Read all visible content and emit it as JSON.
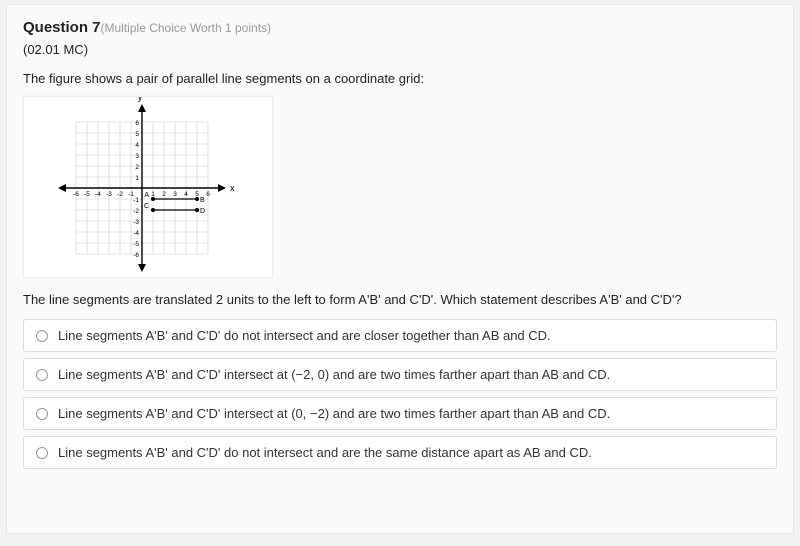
{
  "question": {
    "title": "Question 7",
    "meta": "(Multiple Choice Worth 1 points)",
    "code": "(02.01 MC)",
    "prompt1": "The figure shows a pair of parallel line segments on a coordinate grid:",
    "prompt2": "The line segments are translated 2 units to the left to form A'B' and C'D'. Which statement describes A'B' and C'D'?"
  },
  "options": [
    "Line segments A'B' and C'D' do not intersect and are closer together than AB and CD.",
    "Line segments A'B' and C'D' intersect at (−2, 0) and are two times farther apart than AB and CD.",
    "Line segments A'B' and C'D' intersect at (0, −2) and are two times farther apart than AB and CD.",
    "Line segments A'B' and C'D' do not intersect and are the same distance apart as AB and CD."
  ],
  "chart_data": {
    "type": "diagram",
    "title": "",
    "xlabel": "x",
    "ylabel": "y",
    "xlim": [
      -6,
      6
    ],
    "ylim": [
      -6,
      6
    ],
    "xticks": [
      -6,
      -5,
      -4,
      -3,
      -2,
      -1,
      0,
      1,
      2,
      3,
      4,
      5,
      6
    ],
    "yticks": [
      -6,
      -5,
      -4,
      -3,
      -2,
      -1,
      1,
      2,
      3,
      4,
      5,
      6
    ],
    "grid": true,
    "segments": [
      {
        "name": "AB",
        "p1": {
          "label": "A",
          "x": 1,
          "y": -1
        },
        "p2": {
          "label": "B",
          "x": 5,
          "y": -1
        }
      },
      {
        "name": "CD",
        "p1": {
          "label": "C",
          "x": 1,
          "y": -2
        },
        "p2": {
          "label": "D",
          "x": 5,
          "y": -2
        }
      }
    ]
  }
}
